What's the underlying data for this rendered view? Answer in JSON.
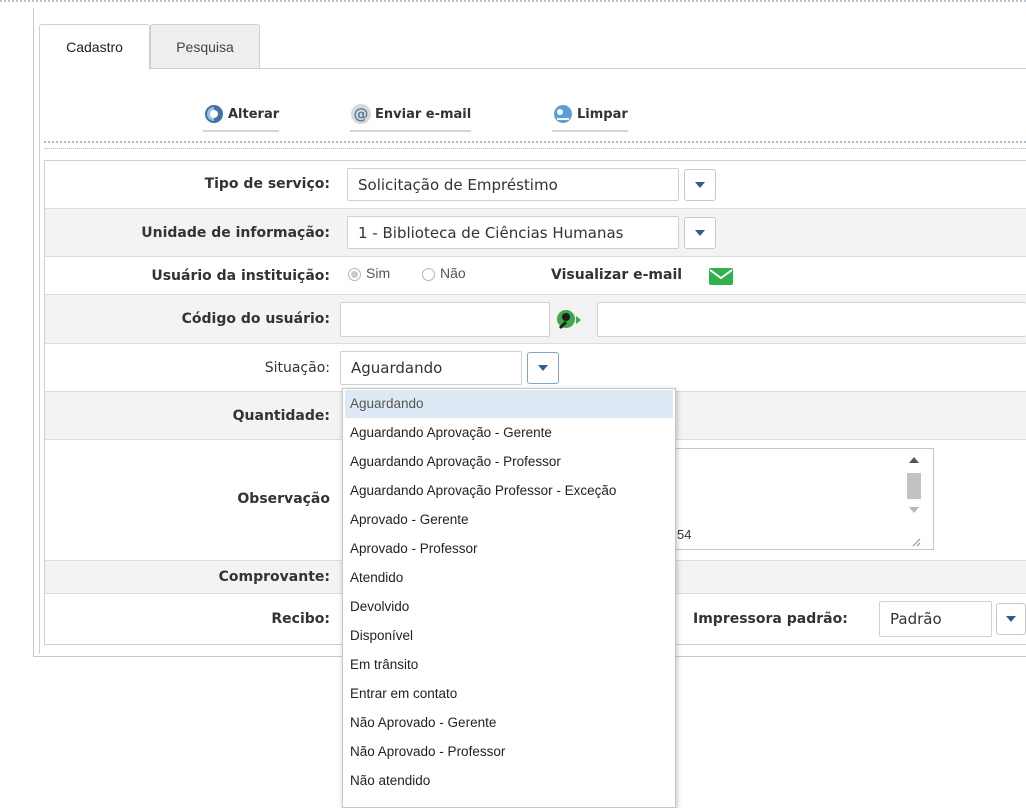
{
  "tabs": [
    {
      "label": "Cadastro",
      "active": true
    },
    {
      "label": "Pesquisa",
      "active": false
    }
  ],
  "toolbar": {
    "alterar": "Alterar",
    "enviar_email": "Enviar e-mail",
    "limpar": "Limpar"
  },
  "form": {
    "tipo_servico": {
      "label": "Tipo de serviço:",
      "value": "Solicitação de Empréstimo"
    },
    "unidade_informacao": {
      "label": "Unidade de informação:",
      "value": "1 - Biblioteca de Ciências Humanas"
    },
    "usuario_instituicao": {
      "label": "Usuário da instituição:",
      "options": [
        "Sim",
        "Não"
      ],
      "selected": "Sim",
      "visualizar_email": "Visualizar e-mail"
    },
    "codigo_usuario": {
      "label": "Código do usuário:",
      "value": "",
      "name_value": ""
    },
    "situacao": {
      "label": "Situação:",
      "value": "Aguardando"
    },
    "quantidade": {
      "label": "Quantidade:"
    },
    "observacao": {
      "label": "Observação",
      "visible_fragment": "54"
    },
    "comprovante": {
      "label": "Comprovante:"
    },
    "recibo": {
      "label": "Recibo:"
    },
    "impressora": {
      "label": "Impressora padrão:",
      "value": "Padrão"
    }
  },
  "situacao_options": [
    "Aguardando",
    "Aguardando Aprovação - Gerente",
    "Aguardando Aprovação - Professor",
    "Aguardando Aprovação Professor - Exceção",
    "Aprovado - Gerente",
    "Aprovado - Professor",
    "Atendido",
    "Devolvido",
    "Disponível",
    "Em trânsito",
    "Entrar em contato",
    "Não Aprovado - Gerente",
    "Não Aprovado - Professor",
    "Não atendido"
  ],
  "colors": {
    "accent": "#2d5d8f",
    "row_alt": "#f3f3f3",
    "border": "#cfcfcf",
    "selected_option": "#dde9f4",
    "email_green": "#2fb24c"
  },
  "icons": {
    "alterar": "refresh-icon",
    "enviar_email": "at-sign-icon",
    "limpar": "clear-icon",
    "visualizar_email": "envelope-icon",
    "codigo_usuario": "search-user-icon"
  }
}
